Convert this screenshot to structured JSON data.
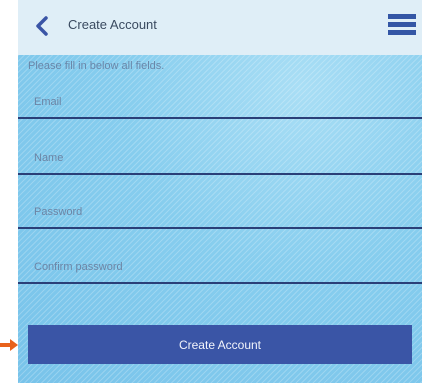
{
  "header": {
    "back_icon": "chevron-left-icon",
    "title": "Create Account",
    "menu_icon": "hamburger-menu-icon"
  },
  "form": {
    "instructions": "Please fill in below all fields.",
    "fields": [
      {
        "placeholder": "Email",
        "value": ""
      },
      {
        "placeholder": "Name",
        "value": ""
      },
      {
        "placeholder": "Password",
        "value": ""
      },
      {
        "placeholder": "Confirm password",
        "value": ""
      }
    ],
    "submit_label": "Create Account"
  },
  "colors": {
    "header_background": "#dfeef7",
    "form_background": "#86cdee",
    "accent": "#3a55a6",
    "field_underline": "#2a3f78",
    "callout_arrow": "#e8621c"
  }
}
